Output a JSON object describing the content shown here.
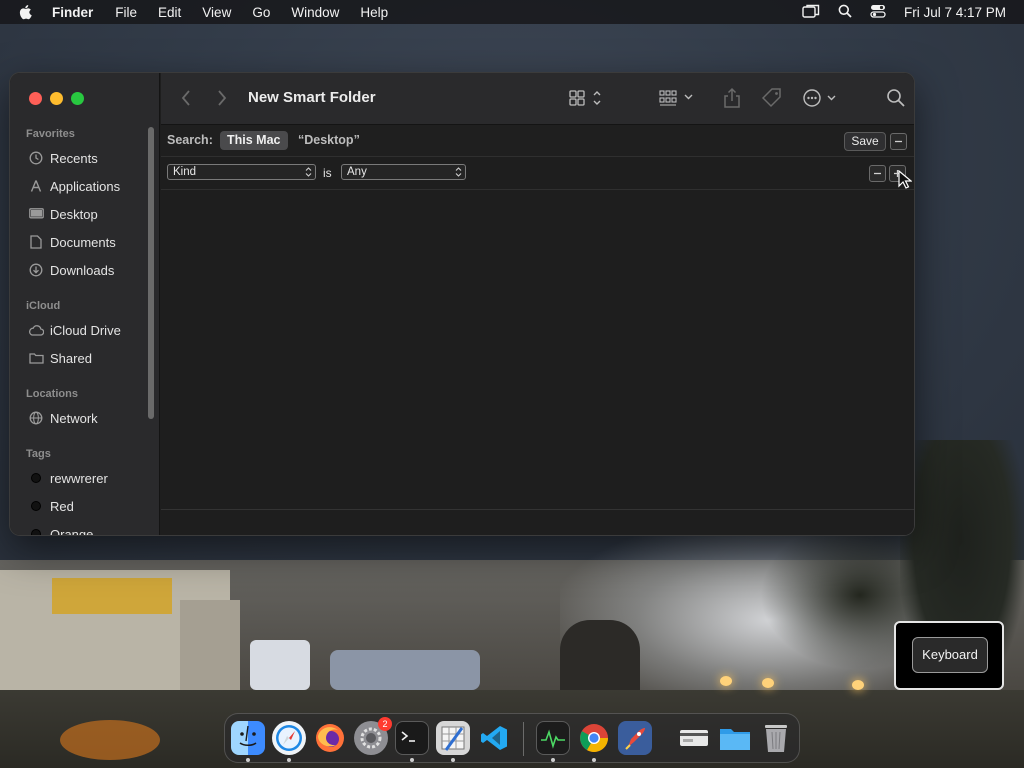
{
  "menubar": {
    "app_name": "Finder",
    "menus": [
      "File",
      "Edit",
      "View",
      "Go",
      "Window",
      "Help"
    ],
    "clock": "Fri Jul 7  4:17 PM"
  },
  "sidebar": {
    "sections": {
      "favorites": "Favorites",
      "icloud": "iCloud",
      "locations": "Locations",
      "tags": "Tags"
    },
    "favorites": [
      {
        "label": "Recents",
        "icon": "clock-icon"
      },
      {
        "label": "Applications",
        "icon": "applications-icon"
      },
      {
        "label": "Desktop",
        "icon": "desktop-icon"
      },
      {
        "label": "Documents",
        "icon": "document-icon"
      },
      {
        "label": "Downloads",
        "icon": "download-icon"
      }
    ],
    "icloud": [
      {
        "label": "iCloud Drive",
        "icon": "cloud-icon"
      },
      {
        "label": "Shared",
        "icon": "shared-folder-icon"
      }
    ],
    "locations": [
      {
        "label": "Network",
        "icon": "globe-icon"
      }
    ],
    "tags": [
      {
        "label": "rewwrerer",
        "color": "#111111"
      },
      {
        "label": "Red",
        "color": "#111111"
      },
      {
        "label": "Orange",
        "color": "#111111"
      }
    ]
  },
  "toolbar": {
    "title": "New Smart Folder"
  },
  "search": {
    "label": "Search:",
    "scope_active": "This Mac",
    "scope_other": "“Desktop”",
    "save_label": "Save"
  },
  "criteria": {
    "attribute": "Kind",
    "operator": "is",
    "value": "Any"
  },
  "keyboard_popup": {
    "label": "Keyboard"
  },
  "dock": {
    "apps": [
      "finder-icon",
      "safari-icon",
      "firefox-icon",
      "system-settings-icon",
      "terminal-icon",
      "script-editor-icon",
      "vscode-icon",
      "activity-monitor-icon",
      "chrome-icon",
      "rocket-typist-icon",
      "downloads-stack-icon",
      "folder-icon",
      "trash-icon"
    ],
    "settings_badge": "2"
  },
  "colors": {
    "close": "#fe5f57",
    "minimize": "#febc2e",
    "maximize": "#28c840",
    "badge": "#ff3b30"
  }
}
